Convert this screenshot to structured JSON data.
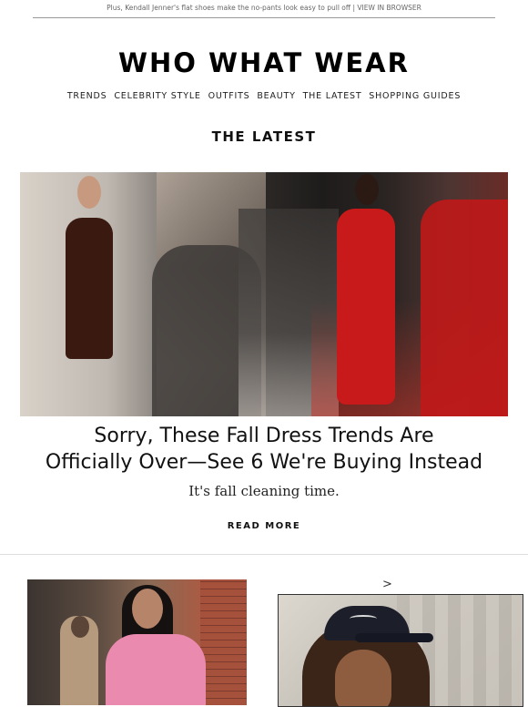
{
  "preheader": {
    "text": "Plus, Kendall Jenner's flat shoes make the no-pants look easy to pull off |",
    "link": "VIEW IN BROWSER"
  },
  "brand": {
    "logo": "WHO WHAT WEAR"
  },
  "nav": {
    "items": [
      "TRENDS",
      "CELEBRITY STYLE",
      "OUTFITS",
      "BEAUTY",
      "THE LATEST",
      "SHOPPING GUIDES"
    ]
  },
  "section": {
    "title": "THE LATEST"
  },
  "feature": {
    "headline_line1": "Sorry, These Fall Dress Trends Are",
    "headline_line2": "Officially Over—See 6 We're Buying Instead",
    "dek": "It's fall cleaning time.",
    "cta": "READ MORE"
  },
  "secondary": {
    "chevron": ">"
  }
}
